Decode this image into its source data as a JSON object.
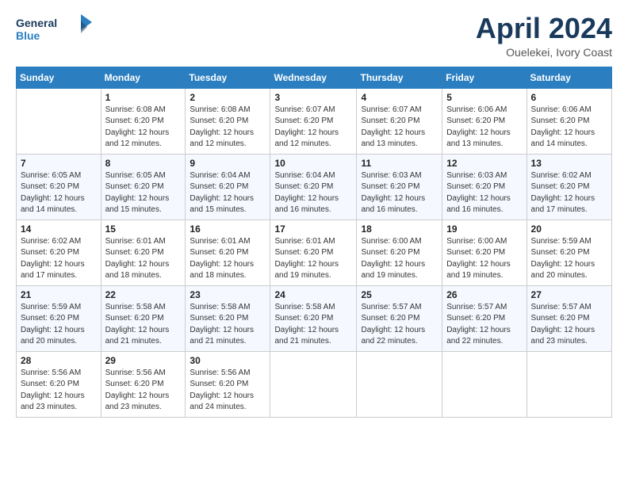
{
  "header": {
    "logo_line1": "General",
    "logo_line2": "Blue",
    "month": "April 2024",
    "location": "Ouelekei, Ivory Coast"
  },
  "columns": [
    "Sunday",
    "Monday",
    "Tuesday",
    "Wednesday",
    "Thursday",
    "Friday",
    "Saturday"
  ],
  "weeks": [
    [
      {
        "day": "",
        "info": ""
      },
      {
        "day": "1",
        "info": "Sunrise: 6:08 AM\nSunset: 6:20 PM\nDaylight: 12 hours\nand 12 minutes."
      },
      {
        "day": "2",
        "info": "Sunrise: 6:08 AM\nSunset: 6:20 PM\nDaylight: 12 hours\nand 12 minutes."
      },
      {
        "day": "3",
        "info": "Sunrise: 6:07 AM\nSunset: 6:20 PM\nDaylight: 12 hours\nand 12 minutes."
      },
      {
        "day": "4",
        "info": "Sunrise: 6:07 AM\nSunset: 6:20 PM\nDaylight: 12 hours\nand 13 minutes."
      },
      {
        "day": "5",
        "info": "Sunrise: 6:06 AM\nSunset: 6:20 PM\nDaylight: 12 hours\nand 13 minutes."
      },
      {
        "day": "6",
        "info": "Sunrise: 6:06 AM\nSunset: 6:20 PM\nDaylight: 12 hours\nand 14 minutes."
      }
    ],
    [
      {
        "day": "7",
        "info": "Sunrise: 6:05 AM\nSunset: 6:20 PM\nDaylight: 12 hours\nand 14 minutes."
      },
      {
        "day": "8",
        "info": "Sunrise: 6:05 AM\nSunset: 6:20 PM\nDaylight: 12 hours\nand 15 minutes."
      },
      {
        "day": "9",
        "info": "Sunrise: 6:04 AM\nSunset: 6:20 PM\nDaylight: 12 hours\nand 15 minutes."
      },
      {
        "day": "10",
        "info": "Sunrise: 6:04 AM\nSunset: 6:20 PM\nDaylight: 12 hours\nand 16 minutes."
      },
      {
        "day": "11",
        "info": "Sunrise: 6:03 AM\nSunset: 6:20 PM\nDaylight: 12 hours\nand 16 minutes."
      },
      {
        "day": "12",
        "info": "Sunrise: 6:03 AM\nSunset: 6:20 PM\nDaylight: 12 hours\nand 16 minutes."
      },
      {
        "day": "13",
        "info": "Sunrise: 6:02 AM\nSunset: 6:20 PM\nDaylight: 12 hours\nand 17 minutes."
      }
    ],
    [
      {
        "day": "14",
        "info": "Sunrise: 6:02 AM\nSunset: 6:20 PM\nDaylight: 12 hours\nand 17 minutes."
      },
      {
        "day": "15",
        "info": "Sunrise: 6:01 AM\nSunset: 6:20 PM\nDaylight: 12 hours\nand 18 minutes."
      },
      {
        "day": "16",
        "info": "Sunrise: 6:01 AM\nSunset: 6:20 PM\nDaylight: 12 hours\nand 18 minutes."
      },
      {
        "day": "17",
        "info": "Sunrise: 6:01 AM\nSunset: 6:20 PM\nDaylight: 12 hours\nand 19 minutes."
      },
      {
        "day": "18",
        "info": "Sunrise: 6:00 AM\nSunset: 6:20 PM\nDaylight: 12 hours\nand 19 minutes."
      },
      {
        "day": "19",
        "info": "Sunrise: 6:00 AM\nSunset: 6:20 PM\nDaylight: 12 hours\nand 19 minutes."
      },
      {
        "day": "20",
        "info": "Sunrise: 5:59 AM\nSunset: 6:20 PM\nDaylight: 12 hours\nand 20 minutes."
      }
    ],
    [
      {
        "day": "21",
        "info": "Sunrise: 5:59 AM\nSunset: 6:20 PM\nDaylight: 12 hours\nand 20 minutes."
      },
      {
        "day": "22",
        "info": "Sunrise: 5:58 AM\nSunset: 6:20 PM\nDaylight: 12 hours\nand 21 minutes."
      },
      {
        "day": "23",
        "info": "Sunrise: 5:58 AM\nSunset: 6:20 PM\nDaylight: 12 hours\nand 21 minutes."
      },
      {
        "day": "24",
        "info": "Sunrise: 5:58 AM\nSunset: 6:20 PM\nDaylight: 12 hours\nand 21 minutes."
      },
      {
        "day": "25",
        "info": "Sunrise: 5:57 AM\nSunset: 6:20 PM\nDaylight: 12 hours\nand 22 minutes."
      },
      {
        "day": "26",
        "info": "Sunrise: 5:57 AM\nSunset: 6:20 PM\nDaylight: 12 hours\nand 22 minutes."
      },
      {
        "day": "27",
        "info": "Sunrise: 5:57 AM\nSunset: 6:20 PM\nDaylight: 12 hours\nand 23 minutes."
      }
    ],
    [
      {
        "day": "28",
        "info": "Sunrise: 5:56 AM\nSunset: 6:20 PM\nDaylight: 12 hours\nand 23 minutes."
      },
      {
        "day": "29",
        "info": "Sunrise: 5:56 AM\nSunset: 6:20 PM\nDaylight: 12 hours\nand 23 minutes."
      },
      {
        "day": "30",
        "info": "Sunrise: 5:56 AM\nSunset: 6:20 PM\nDaylight: 12 hours\nand 24 minutes."
      },
      {
        "day": "",
        "info": ""
      },
      {
        "day": "",
        "info": ""
      },
      {
        "day": "",
        "info": ""
      },
      {
        "day": "",
        "info": ""
      }
    ]
  ]
}
